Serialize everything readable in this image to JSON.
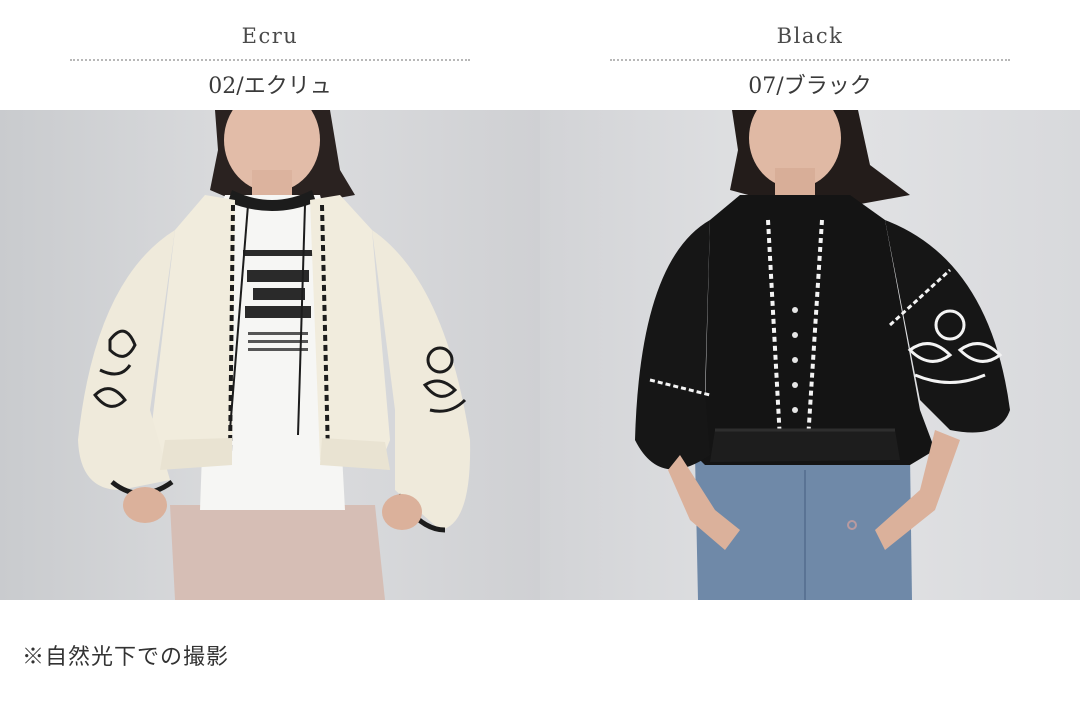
{
  "variants": [
    {
      "color_en": "Ecru",
      "color_code_jp": "02/エクリュ",
      "photo_icon": "model-photo-icon",
      "top_colors": {
        "background": "#d9dadc",
        "garment": "#f1ecdd",
        "trim": "#1c1c1c",
        "tee": "#f6f6f4",
        "pants": "#d6beb5"
      }
    },
    {
      "color_en": "Black",
      "color_code_jp": "07/ブラック",
      "photo_icon": "model-photo-icon",
      "top_colors": {
        "background": "#e0e1e3",
        "garment": "#141414",
        "trim": "#f4f4f4",
        "pants": "#6f89a8"
      }
    }
  ],
  "footer": {
    "note": "※自然光下での撮影"
  }
}
